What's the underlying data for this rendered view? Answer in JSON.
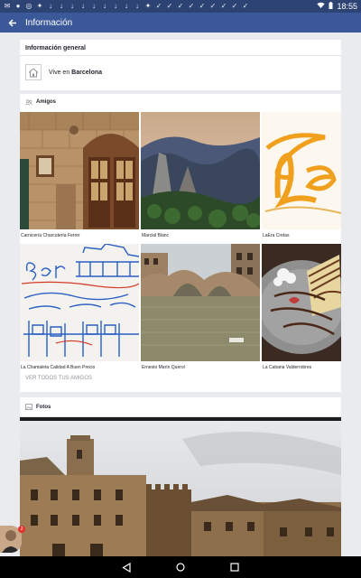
{
  "status_bar": {
    "time": "18:55",
    "left_icons": [
      "mail-icon",
      "message-icon",
      "instagram-icon",
      "twitter-icon",
      "download-icon",
      "download-icon",
      "download-icon",
      "download-icon",
      "download-icon",
      "download-icon",
      "download-icon",
      "download-icon",
      "download-icon",
      "twitter-icon",
      "check-icon",
      "check-icon",
      "check-icon",
      "check-icon",
      "check-icon",
      "check-icon",
      "check-icon",
      "check-icon",
      "check-icon"
    ],
    "right_icons": [
      "wifi-icon",
      "battery-icon"
    ]
  },
  "app_bar": {
    "title": "Información",
    "color": "#3b5998"
  },
  "info": {
    "header": "Información general",
    "lives_prefix": "Vive en ",
    "lives_city": "Barcelona"
  },
  "friends": {
    "header": "Amigos",
    "items": [
      {
        "name": "Carnicería Charcutería Ferrer"
      },
      {
        "name": "Marcial Blanc"
      },
      {
        "name": "LaEra Cretas"
      },
      {
        "name": "La Chamaleta Calidad A Buen Precio"
      },
      {
        "name": "Ernesto Marín Querol"
      },
      {
        "name": "La Cabana Valderrobres"
      }
    ],
    "see_all": "VER TODOS TUS AMIGOS"
  },
  "photos": {
    "header": "Fotos"
  },
  "chat_head": {
    "badge": "2"
  }
}
